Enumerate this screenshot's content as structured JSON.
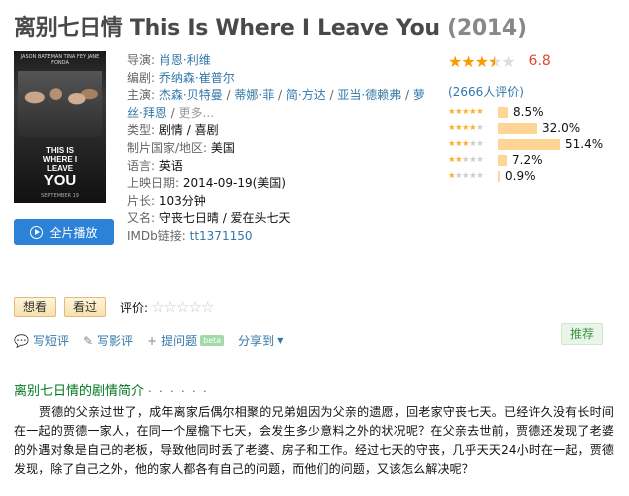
{
  "header": {
    "title_cn": "离别七日情",
    "title_en": "This Is Where I Leave You",
    "year": "(2014)"
  },
  "poster": {
    "top_text": "JASON BATEMAN  TINA FEY  JANE FONDA",
    "title_line1": "THIS IS",
    "title_line2": "WHERE I",
    "title_line3": "LEAVE",
    "title_line4": "YOU",
    "date_text": "SEPTEMBER 19"
  },
  "play_button": {
    "label": "全片播放",
    "icon": "play-circle-icon"
  },
  "info": {
    "director_label": "导演",
    "director": "肖恩·利维",
    "writer_label": "编剧",
    "writer": "乔纳森·崔普尔",
    "cast_label": "主演",
    "cast": [
      "杰森·贝特曼",
      "蒂娜·菲",
      "简·方达",
      "亚当·德赖弗",
      "萝丝·拜恩"
    ],
    "cast_more": "更多...",
    "genre_label": "类型:",
    "genres": [
      "剧情",
      "喜剧"
    ],
    "region_label": "制片国家/地区:",
    "region": "美国",
    "language_label": "语言:",
    "language": "英语",
    "release_label": "上映日期:",
    "release": "2014-09-19(美国)",
    "runtime_label": "片长:",
    "runtime": "103分钟",
    "aka_label": "又名:",
    "aka": "守丧七日晴 / 爱在头七天",
    "imdb_label": "IMDb链接:",
    "imdb": "tt1371150"
  },
  "rating": {
    "score": "6.8",
    "stars_value": 3.5,
    "votes": "(2666人评价)",
    "distribution": [
      {
        "stars": 5,
        "percent": 8.5,
        "label": "8.5%"
      },
      {
        "stars": 4,
        "percent": 32.0,
        "label": "32.0%"
      },
      {
        "stars": 3,
        "percent": 51.4,
        "label": "51.4%"
      },
      {
        "stars": 2,
        "percent": 7.2,
        "label": "7.2%"
      },
      {
        "stars": 1,
        "percent": 0.9,
        "label": "0.9%"
      }
    ]
  },
  "actions": {
    "want_label": "想看",
    "seen_label": "看过",
    "rate_label": "评价:",
    "short_review": "写短评",
    "long_review": "写影评",
    "ask": "提问题",
    "beta": "beta",
    "share": "分享到",
    "recommend": "推荐"
  },
  "synopsis": {
    "heading": "离别七日情的剧情简介",
    "dots": "· · · · · ·",
    "text": "贾德的父亲过世了，成年离家后偶尔相聚的兄弟姐因为父亲的遗愿，回老家守丧七天。已经许久没有长时间在一起的贾德一家人，在同一个屋檐下七天，会发生多少意料之外的状况呢？在父亲去世前，贾德还发现了老婆的外遇对象是自己的老板，导致他同时丢了老婆、房子和工作。经过七天的守丧，几乎天天24小时在一起，贾德发现，除了自己之外，他的家人都各有自己的问题，而他们的问题，又该怎么解决呢？"
  }
}
